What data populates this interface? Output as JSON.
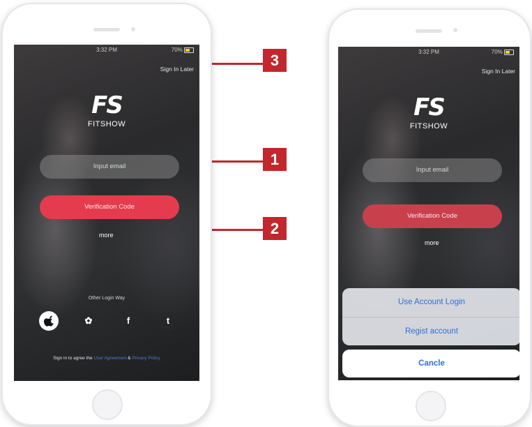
{
  "left_phone": {
    "status": {
      "time": "3:32 PM",
      "battery": "70%"
    },
    "sign_in_later": "Sign In Later",
    "logo": {
      "mark": "FS",
      "text": "FITSHOW"
    },
    "email_placeholder": "Input email",
    "verification_button": "Verification Code",
    "more_link": "more",
    "other_login_label": "Other Login Way",
    "social_icons": [
      "apple-icon",
      "wechat-icon",
      "facebook-icon",
      "twitter-icon"
    ],
    "social_glyphs": [
      "",
      "✿",
      "f",
      "t"
    ],
    "agree": {
      "prefix": "Sign in to agree the",
      "user_agreement": "User Agreement",
      "and": "&",
      "privacy": "Privacy Policy"
    }
  },
  "right_phone": {
    "status": {
      "time": "3:32 PM",
      "battery": "70%"
    },
    "sign_in_later": "Sign In Later",
    "logo": {
      "mark": "FS",
      "text": "FITSHOW"
    },
    "email_placeholder": "Input email",
    "verification_button": "Verification Code",
    "more_link": "more",
    "action_sheet": {
      "items": [
        "Use Account Login",
        "Regist account"
      ],
      "cancel": "Cancle"
    }
  },
  "callouts": [
    "1",
    "2",
    "3"
  ],
  "colors": {
    "accent": "#e43c4e",
    "callout": "#c2272d",
    "sheet_text": "#2f6fd8"
  }
}
